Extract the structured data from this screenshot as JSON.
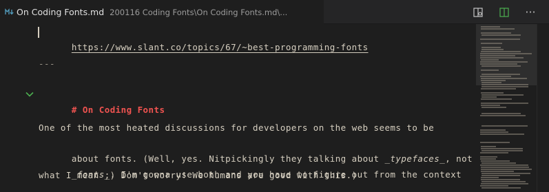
{
  "tab": {
    "icon": "markdown-icon",
    "title": "On Coding Fonts.md",
    "path": "200116 Coding Fonts\\On Coding Fonts.md\\..."
  },
  "actions": {
    "preview_icon": "open-preview-icon",
    "split_icon": "split-editor-icon",
    "more_icon": "more-actions-icon",
    "more_label": "···"
  },
  "editor": {
    "link": "https://www.slant.co/topics/67/~best-programming-fonts",
    "hr": "---",
    "heading_hash": "#",
    "heading_text": "On Coding Fonts",
    "para_line1": "One of the most heated discussions for developers on the web seems to be",
    "para_line2_a": "about fonts. (Well, yes. Nitpickingly they talking about ",
    "para_line2_b": "_typefaces_",
    "para_line2_c": ", not",
    "para_line3_a": "_fonts_",
    "para_line3_b": ". I'm gonna use both and you have to figure out from the context",
    "para_line4": "what I mean ;) Don't worry! We humans are good with this.)"
  },
  "colors": {
    "background": "#1e1e1e",
    "text": "#d6cfc0",
    "heading": "#ef5350",
    "fold_chevron": "#4caf50"
  }
}
